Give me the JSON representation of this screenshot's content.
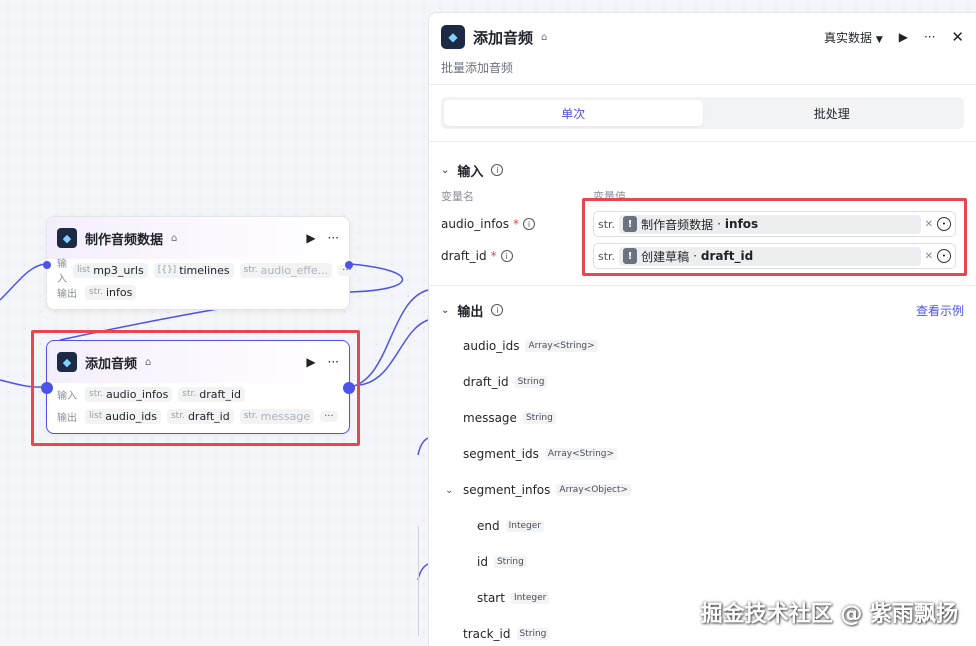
{
  "canvas": {
    "nodes": [
      {
        "title": "制作音频数据",
        "inputs_label": "输入",
        "inputs": [
          {
            "type": "list",
            "name": "mp3_urls"
          },
          {
            "type": "[{}]",
            "name": "timelines"
          },
          {
            "type": "str.",
            "name": "audio_effe..."
          }
        ],
        "outputs_label": "输出",
        "outputs": [
          {
            "type": "str.",
            "name": "infos"
          }
        ]
      },
      {
        "title": "添加音频",
        "inputs_label": "输入",
        "inputs": [
          {
            "type": "str.",
            "name": "audio_infos"
          },
          {
            "type": "str.",
            "name": "draft_id"
          }
        ],
        "outputs_label": "输出",
        "outputs": [
          {
            "type": "list",
            "name": "audio_ids"
          },
          {
            "type": "str.",
            "name": "draft_id"
          },
          {
            "type": "str.",
            "name": "message"
          }
        ]
      }
    ],
    "more_label": "···"
  },
  "panel": {
    "title": "添加音频",
    "description": "批量添加音频",
    "data_mode": "真实数据",
    "tabs": [
      "单次",
      "批处理"
    ],
    "input_section": {
      "title": "输入",
      "col_name": "变量名",
      "col_value": "变量值",
      "rows": [
        {
          "name": "audio_infos",
          "type": "str.",
          "ref_node": "制作音频数据",
          "ref_var": "infos"
        },
        {
          "name": "draft_id",
          "type": "str.",
          "ref_node": "创建草稿",
          "ref_var": "draft_id"
        }
      ]
    },
    "output_section": {
      "title": "输出",
      "example_link": "查看示例",
      "rows": [
        {
          "name": "audio_ids",
          "type": "Array<String>"
        },
        {
          "name": "draft_id",
          "type": "String"
        },
        {
          "name": "message",
          "type": "String"
        },
        {
          "name": "segment_ids",
          "type": "Array<String>"
        },
        {
          "name": "segment_infos",
          "type": "Array<Object>"
        }
      ],
      "children": [
        {
          "name": "end",
          "type": "Integer"
        },
        {
          "name": "id",
          "type": "String"
        },
        {
          "name": "start",
          "type": "Integer"
        }
      ],
      "last_row": {
        "name": "track_id",
        "type": "String"
      }
    }
  },
  "watermark": "掘金技术社区 @ 紫雨飘扬",
  "colors": {
    "accent": "#4d53e8",
    "highlight": "#e5484d"
  }
}
